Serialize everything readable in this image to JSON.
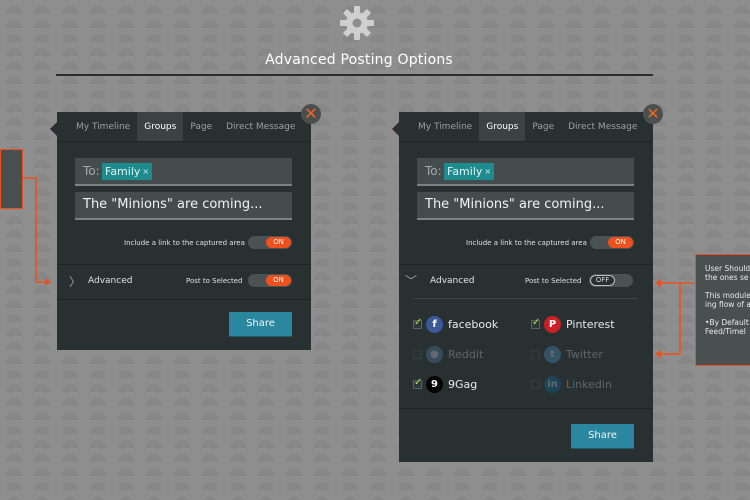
{
  "page": {
    "title": "Advanced Posting Options"
  },
  "colors": {
    "accent_orange": "#f0501e",
    "teal_chip": "#1e8b8f",
    "share_blue": "#2b87a0",
    "panel_bg": "#283032"
  },
  "icons": {
    "header": "gear-icon",
    "close": "close-icon"
  },
  "left_panel": {
    "tabs": [
      "My Timeline",
      "Groups",
      "Page",
      "Direct Message"
    ],
    "active_tab": "Groups",
    "close_glyph": "✕",
    "to_label": "To:",
    "to_chip": "Family",
    "chip_remove": "×",
    "message": "The \"Minions\" are coming...",
    "include_link_label": "Include a link to the captured area",
    "include_link_toggle": "ON",
    "advanced_chevron": "〉",
    "advanced_label": "Advanced",
    "post_selected_label": "Post to Selected",
    "post_selected_toggle": "ON",
    "share_label": "Share"
  },
  "right_panel": {
    "tabs": [
      "My Timeline",
      "Groups",
      "Page",
      "Direct Message"
    ],
    "active_tab": "Groups",
    "close_glyph": "✕",
    "to_label": "To:",
    "to_chip": "Family",
    "chip_remove": "×",
    "message": "The \"Minions\" are coming...",
    "include_link_label": "Include a link to the captured area",
    "include_link_toggle": "ON",
    "advanced_chevron": "﹀",
    "advanced_label": "Advanced",
    "post_selected_label": "Post to Selected",
    "post_selected_toggle": "OFF",
    "networks": [
      {
        "name": "facebook",
        "checked": true,
        "enabled": true,
        "icon": "facebook-icon",
        "glyph": "f",
        "color": "#3b5998"
      },
      {
        "name": "Pinterest",
        "checked": true,
        "enabled": true,
        "icon": "pinterest-icon",
        "glyph": "P",
        "color": "#cb2027"
      },
      {
        "name": "Reddit",
        "checked": false,
        "enabled": false,
        "icon": "reddit-icon",
        "glyph": "●",
        "color": "#5f99cf"
      },
      {
        "name": "Twitter",
        "checked": false,
        "enabled": false,
        "icon": "twitter-icon",
        "glyph": "t",
        "color": "#55acee"
      },
      {
        "name": "9Gag",
        "checked": true,
        "enabled": true,
        "icon": "9gag-icon",
        "glyph": "9",
        "color": "#000000"
      },
      {
        "name": "Linkedin",
        "checked": false,
        "enabled": false,
        "icon": "linkedin-icon",
        "glyph": "in",
        "color": "#0077b5"
      }
    ],
    "share_label": "Share"
  },
  "callout_right": {
    "lines": [
      "User Should",
      "the ones se",
      "This module",
      "ing flow of a",
      "•By Default",
      "Feed/Timel"
    ]
  }
}
